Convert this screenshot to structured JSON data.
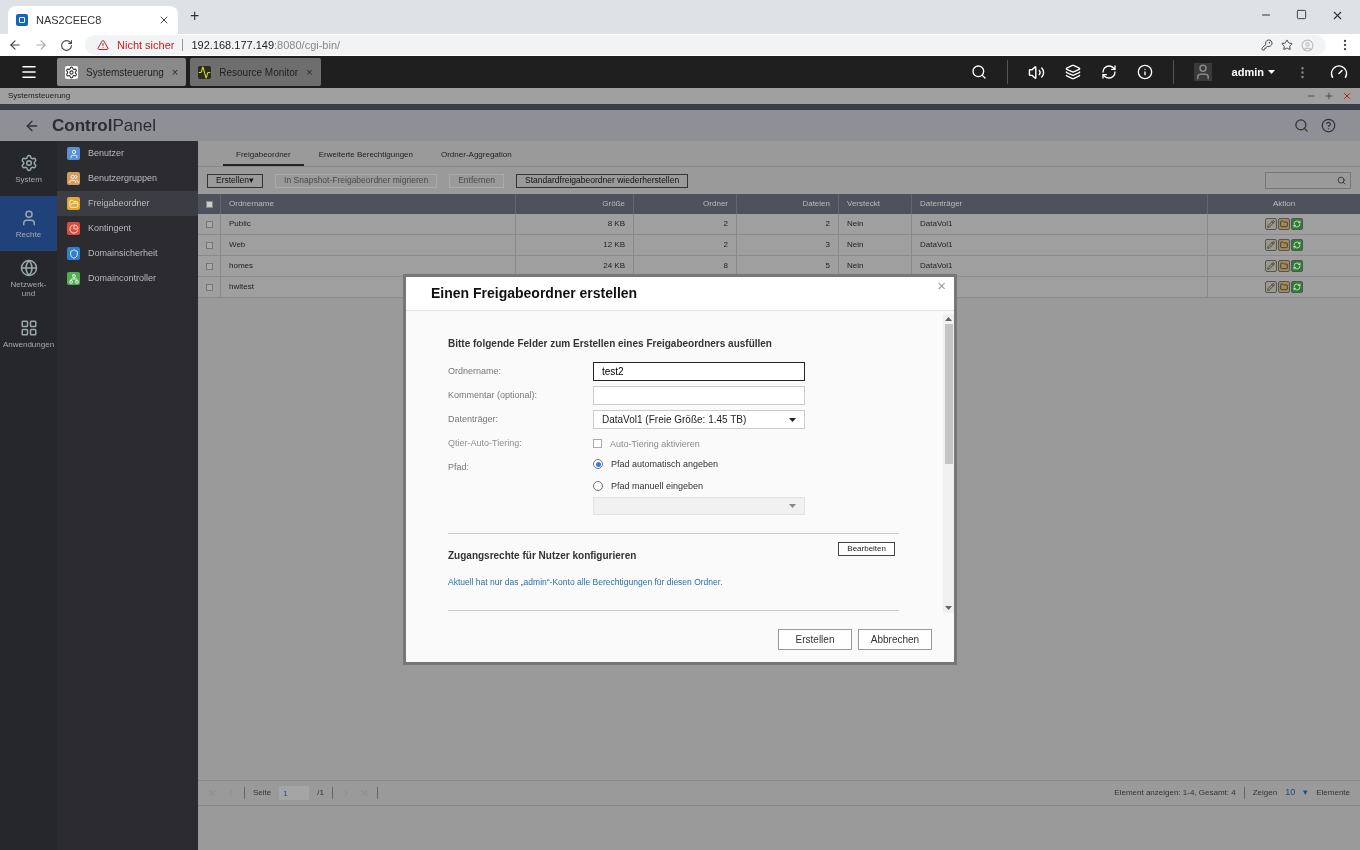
{
  "browser": {
    "tab_title": "NAS2CEEC8",
    "new_tab": "+",
    "security": "Nicht sicher",
    "url_host": "192.168.177.149",
    "url_rest": ":8080/cgi-bin/"
  },
  "app_tabs": [
    {
      "label": "Systemsteuerung",
      "selected": true,
      "close": "×"
    },
    {
      "label": "Resource Monitor",
      "selected": false,
      "close": "×"
    }
  ],
  "user": "admin",
  "breadcrumb": "Systemsteuerung",
  "header": {
    "title_bold": "Control",
    "title_light": "Panel"
  },
  "rail": [
    {
      "label": "System",
      "selected": false,
      "kind": "gear"
    },
    {
      "label": "Rechte",
      "selected": true,
      "kind": "user"
    },
    {
      "label": "Netzwerk-\nund",
      "selected": false,
      "kind": "globe"
    },
    {
      "label": "Anwendungen",
      "selected": false,
      "kind": "apps"
    }
  ],
  "menu": [
    {
      "label": "Benutzer",
      "selected": false,
      "color": "#5b8fd6"
    },
    {
      "label": "Benutzergruppen",
      "selected": false,
      "color": "#d69a5b"
    },
    {
      "label": "Freigabeordner",
      "selected": true,
      "color": "#e0a82e"
    },
    {
      "label": "Kontingent",
      "selected": false,
      "color": "#e04a3a"
    },
    {
      "label": "Domainsicherheit",
      "selected": false,
      "color": "#2f7fd0"
    },
    {
      "label": "Domaincontroller",
      "selected": false,
      "color": "#4caf50"
    }
  ],
  "tabs": [
    {
      "label": "Freigabeordner",
      "selected": true
    },
    {
      "label": "Erweiterte Berechtigungen",
      "selected": false
    },
    {
      "label": "Ordner-Aggregation",
      "selected": false
    }
  ],
  "toolbar": [
    {
      "label": "Erstellen",
      "disabled": false,
      "caret": "▾"
    },
    {
      "label": "In Snapshot-Freigabeordner migrieren",
      "disabled": true
    },
    {
      "label": "Entfernen",
      "disabled": true
    },
    {
      "label": "Standardfreigabeordner wiederherstellen",
      "disabled": false
    }
  ],
  "table": {
    "all_checked": false,
    "columns": [
      "Ordnername",
      "Größe",
      "Ordner",
      "Dateien",
      "Versteckt",
      "Datenträger",
      "Aktion"
    ],
    "rows": [
      {
        "checked": false,
        "cells": [
          "Public",
          "8 KB",
          "2",
          "2",
          "Nein",
          "DataVol1"
        ]
      },
      {
        "checked": false,
        "cells": [
          "Web",
          "12 KB",
          "2",
          "3",
          "Nein",
          "DataVol1"
        ]
      },
      {
        "checked": false,
        "cells": [
          "homes",
          "24 KB",
          "8",
          "5",
          "Nein",
          "DataVol1"
        ]
      },
      {
        "checked": false,
        "cells": [
          "hwltest"
        ]
      }
    ]
  },
  "pager": {
    "page_label": "Seite",
    "page": "1",
    "total": "/1",
    "summary": "Element anzeigen: 1-4, Gesamt: 4",
    "show": "Zeigen",
    "per_page": "10",
    "caret": "▾",
    "unit": "Elemente"
  },
  "dialog": {
    "title": "Einen Freigabeordner erstellen",
    "close": "×",
    "intro": "Bitte folgende Felder zum Erstellen eines Freigabeordners ausfüllen",
    "fields": [
      {
        "kind": "text",
        "label": "Ordnername:",
        "value": "test2",
        "focused": true
      },
      {
        "kind": "text",
        "label": "Kommentar (optional):",
        "focused": false
      },
      {
        "kind": "select",
        "label": "Datenträger:",
        "value": "DataVol1 (Freie Größe: 1.45 TB)"
      },
      {
        "kind": "checkbox",
        "label": "Qtier-Auto-Tiering:",
        "option": "Auto-Tiering aktivieren",
        "checked": false,
        "disabled": true
      },
      {
        "kind": "radio",
        "label": "Pfad:",
        "options": [
          {
            "label": "Pfad automatisch angeben",
            "selected": true
          },
          {
            "label": "Pfad manuell eingeben",
            "selected": false
          }
        ]
      },
      {
        "kind": "path_select",
        "disabled": true
      }
    ],
    "access_title": "Zugangsrechte für Nutzer konfigurieren",
    "edit": "Bearbeiten",
    "access_note": "Aktuell hat nur das „admin“-Konto alle Berechtigungen für diesen Ordner.",
    "buttons": [
      "Erstellen",
      "Abbrechen"
    ]
  }
}
